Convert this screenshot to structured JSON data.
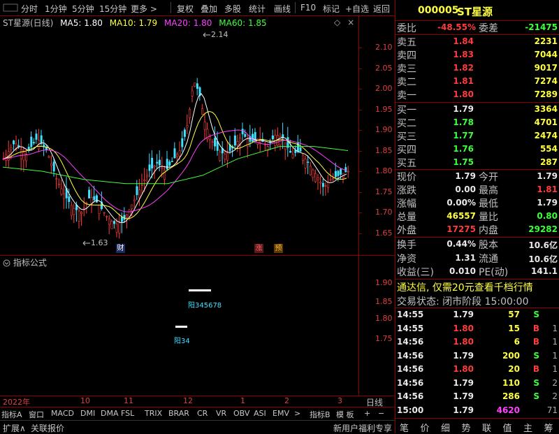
{
  "toolbar": {
    "tabs": [
      "分时",
      "1分钟",
      "5分钟",
      "15分钟",
      "更多 >"
    ],
    "tools": [
      "复权",
      "叠加",
      "多股",
      "统计",
      "画线",
      "F10",
      "标记",
      "+自选",
      "返回"
    ]
  },
  "chart": {
    "title": "ST星源(日线)",
    "ma": [
      {
        "label": "MA5: 1.80",
        "color": "#ffffff"
      },
      {
        "label": "MA10: 1.79",
        "color": "#ffff40"
      },
      {
        "label": "MA20: 1.80",
        "color": "#ff40ff"
      },
      {
        "label": "MA60: 1.85",
        "color": "#40ff40"
      }
    ],
    "price_ticks": [
      "2.10",
      "2.05",
      "2.00",
      "1.95",
      "1.90",
      "1.85",
      "1.80",
      "1.75",
      "1.70",
      "1.65"
    ],
    "high_label": "2.14",
    "low_label": "1.63",
    "markers": {
      "cai": "财",
      "zhang": "涨",
      "yu": "预"
    }
  },
  "indicator": {
    "title": "指标公式",
    "ticks": [
      "1.90",
      "1.85",
      "1.80",
      "1.75"
    ],
    "label1": "阳34",
    "label2": "阳345678"
  },
  "timeaxis": {
    "year": "2022年",
    "months": [
      "10",
      "11",
      "12",
      "1",
      "2",
      "3"
    ],
    "period": "日线"
  },
  "bottom_tabs": [
    "指标A",
    "窗口",
    "MACD",
    "DMI",
    "DMA",
    "FSL",
    "TRIX",
    "BRAR",
    "CR",
    "VR",
    "OBV",
    "ASI",
    "EMV",
    ">",
    "指标B",
    "模 板",
    "+",
    "−"
  ],
  "status_bar": {
    "left1": "扩展∧",
    "left2": "关联报价",
    "right": "新用户福利专享"
  },
  "quote": {
    "code": "000005",
    "name": "ST星源",
    "weibi_label": "委比",
    "weibi": "-48.55%",
    "weicha_label": "委差",
    "weicha": "-21475",
    "asks": [
      {
        "label": "卖五",
        "price": "1.84",
        "vol": "2231"
      },
      {
        "label": "卖四",
        "price": "1.83",
        "vol": "7044"
      },
      {
        "label": "卖三",
        "price": "1.82",
        "vol": "9017"
      },
      {
        "label": "卖二",
        "price": "1.81",
        "vol": "7274"
      },
      {
        "label": "卖一",
        "price": "1.80",
        "vol": "7289"
      }
    ],
    "bids": [
      {
        "label": "买一",
        "price": "1.79",
        "vol": "3364"
      },
      {
        "label": "买二",
        "price": "1.78",
        "vol": "4701"
      },
      {
        "label": "买三",
        "price": "1.77",
        "vol": "2474"
      },
      {
        "label": "买四",
        "price": "1.76",
        "vol": "554"
      },
      {
        "label": "买五",
        "price": "1.75",
        "vol": "287"
      }
    ],
    "stats": [
      {
        "l1": "现价",
        "v1": "1.79",
        "c1": "white",
        "l2": "今开",
        "v2": "1.79",
        "c2": "white"
      },
      {
        "l1": "涨跌",
        "v1": "0.00",
        "c1": "white",
        "l2": "最高",
        "v2": "1.81",
        "c2": "red"
      },
      {
        "l1": "涨幅",
        "v1": "0.00%",
        "c1": "white",
        "l2": "最低",
        "v2": "1.79",
        "c2": "white"
      },
      {
        "l1": "总量",
        "v1": "46557",
        "c1": "yellow",
        "l2": "量比",
        "v2": "0.80",
        "c2": "green"
      },
      {
        "l1": "外盘",
        "v1": "17275",
        "c1": "red",
        "l2": "内盘",
        "v2": "29282",
        "c2": "green"
      }
    ],
    "stats2": [
      {
        "l1": "换手",
        "v1": "0.44%",
        "l2": "股本",
        "v2": "10.6亿"
      },
      {
        "l1": "净资",
        "v1": "1.31",
        "l2": "流通",
        "v2": "10.6亿"
      },
      {
        "l1": "收益(三)",
        "v1": "0.010",
        "l2": "PE(动)",
        "v2": "141.1"
      }
    ],
    "promo": "通达信, 仅需20元查看千档行情",
    "trade_status": "交易状态: 闭市阶段 15:00:00",
    "ticks": [
      {
        "t": "14:55",
        "p": "1.79",
        "pc": "white",
        "v": "57",
        "d": "S",
        "n": ""
      },
      {
        "t": "14:55",
        "p": "1.80",
        "pc": "red",
        "v": "15",
        "d": "B",
        "n": "1"
      },
      {
        "t": "14:56",
        "p": "1.80",
        "pc": "red",
        "v": "6",
        "d": "B",
        "n": "1"
      },
      {
        "t": "14:56",
        "p": "1.79",
        "pc": "white",
        "v": "200",
        "d": "S",
        "n": "1"
      },
      {
        "t": "14:56",
        "p": "1.80",
        "pc": "red",
        "v": "20",
        "d": "B",
        "n": "1"
      },
      {
        "t": "14:56",
        "p": "1.79",
        "pc": "white",
        "v": "110",
        "d": "S",
        "n": "2"
      },
      {
        "t": "14:56",
        "p": "1.79",
        "pc": "white",
        "v": "286",
        "d": "S",
        "n": "2"
      },
      {
        "t": "15:00",
        "p": "1.79",
        "pc": "white",
        "v": "4620",
        "d": "",
        "n": "71"
      }
    ],
    "rb_tabs": [
      "笔",
      "价",
      "细",
      "势",
      "联",
      "值",
      "主",
      "筹"
    ]
  }
}
